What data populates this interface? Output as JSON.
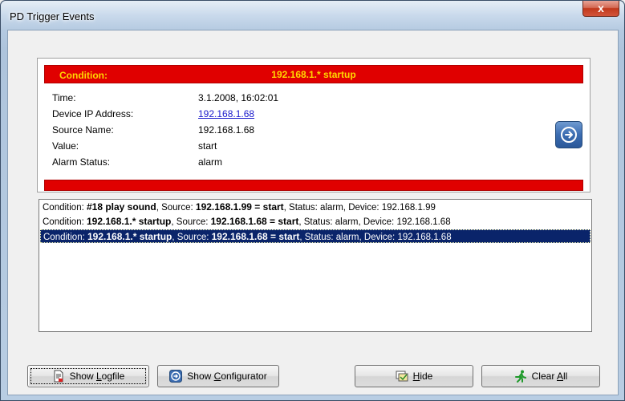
{
  "window": {
    "title": "PD Trigger Events",
    "close_glyph": "x"
  },
  "detail": {
    "condition_label": "Condition:",
    "condition_value": "192.168.1.* startup",
    "fields": [
      {
        "label": "Time:",
        "value": "3.1.2008, 16:02:01"
      },
      {
        "label": "Device IP Address:",
        "value": "192.168.1.68"
      },
      {
        "label": "Source Name:",
        "value": "192.168.1.68"
      },
      {
        "label": "Value:",
        "value": "start"
      },
      {
        "label": "Alarm Status:",
        "value": "alarm"
      }
    ],
    "nav_icon": "arrow-right-circle-icon"
  },
  "events": [
    {
      "p1": "Condition: ",
      "cond": "#18 play sound",
      "p2": ", Source: ",
      "src": "192.168.1.99 = start",
      "p3": ", Status: alarm, Device: 192.168.1.99",
      "selected": false
    },
    {
      "p1": "Condition: ",
      "cond": "192.168.1.* startup",
      "p2": ", Source: ",
      "src": "192.168.1.68 = start",
      "p3": ", Status: alarm, Device: 192.168.1.68",
      "selected": false
    },
    {
      "p1": "Condition: ",
      "cond": "192.168.1.* startup",
      "p2": ", Source: ",
      "src": "192.168.1.68 = start",
      "p3": ", Status: alarm, Device: 192.168.1.68",
      "selected": true
    }
  ],
  "buttons": {
    "show_logfile": {
      "pre": "Show ",
      "key": "L",
      "post": "ogfile"
    },
    "show_configurator": {
      "pre": "Show ",
      "key": "C",
      "post": "onfigurator"
    },
    "hide": {
      "pre": "",
      "key": "H",
      "post": "ide"
    },
    "clear_all": {
      "pre": "Clear ",
      "key": "A",
      "post": "ll"
    }
  },
  "colors": {
    "accent_red": "#e00000",
    "condition_text": "#ffd700",
    "selection": "#0a246a"
  }
}
